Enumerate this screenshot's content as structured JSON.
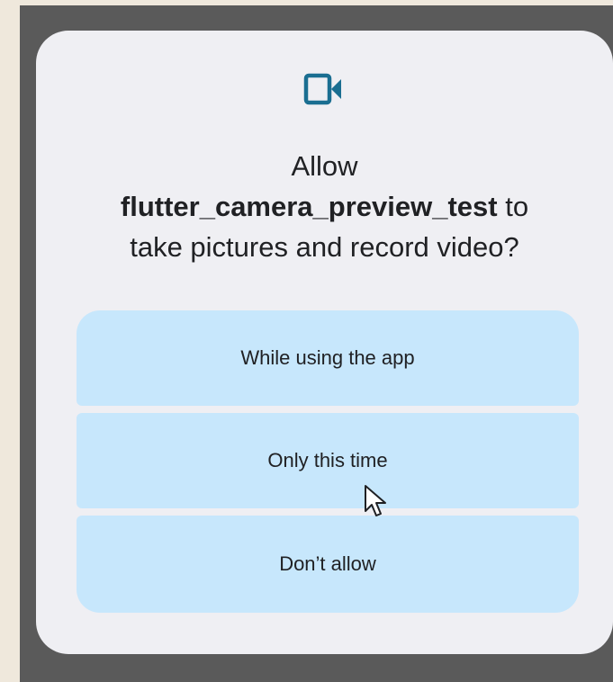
{
  "dialog": {
    "icon": "video-camera-icon",
    "title_prefix": "Allow",
    "app_name": "flutter_camera_preview_test",
    "title_mid": "to",
    "title_suffix": "take pictures and record video?"
  },
  "options": [
    {
      "label": "While using the app"
    },
    {
      "label": "Only this time"
    },
    {
      "label": "Don’t allow"
    }
  ],
  "colors": {
    "accent": "#1a6e91",
    "button_bg": "#c7e7fc",
    "dialog_bg": "#efeff3",
    "scrim": "#5a5a5a"
  },
  "cursor": "mouse-pointer-icon"
}
